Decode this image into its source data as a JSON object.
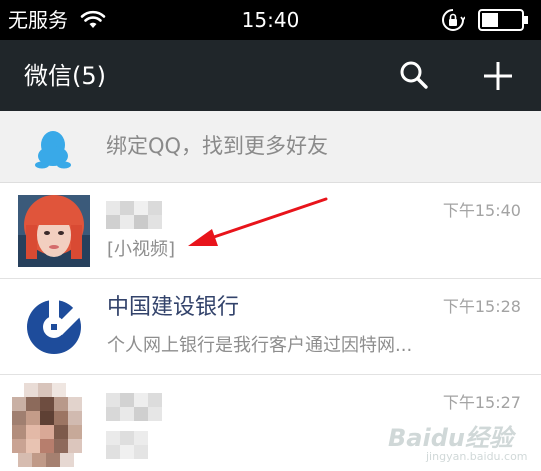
{
  "status_bar": {
    "carrier": "无服务",
    "time": "15:40",
    "icons": [
      "wifi-icon",
      "rotation-lock-icon",
      "battery-icon"
    ]
  },
  "title_bar": {
    "title": "微信(5)",
    "icons": [
      "search-icon",
      "plus-icon"
    ]
  },
  "banner": {
    "text": "绑定QQ，找到更多好友",
    "icon": "qq-penguin-icon"
  },
  "chats": [
    {
      "name": "",
      "preview": "[小视频]",
      "time": "下午15:40"
    },
    {
      "name": "中国建设银行",
      "preview": "个人网上银行是我行客户通过因特网...",
      "time": "下午15:28"
    },
    {
      "name": "",
      "preview": "",
      "time": "下午15:27"
    }
  ],
  "watermark": {
    "text": "Baidu经验",
    "sub": "jingyan.baidu.com"
  },
  "colors": {
    "status_bar_bg": "#000000",
    "title_bar_bg": "#20262a",
    "banner_bg": "#f1f1f1",
    "qq_blue": "#39a9e8",
    "name_blue": "#33436b",
    "ccb_blue": "#1e4c9b",
    "arrow_red": "#e8141b"
  }
}
